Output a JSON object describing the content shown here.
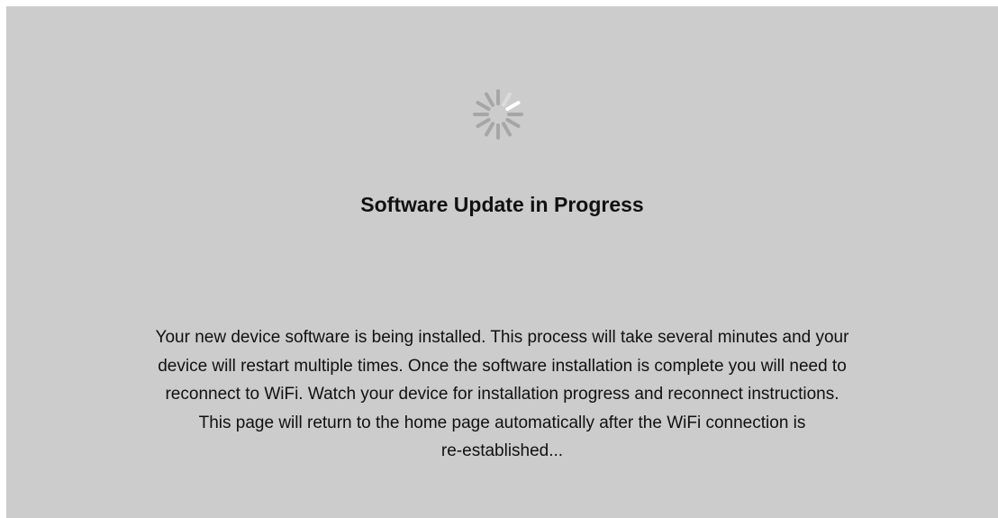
{
  "status": {
    "icon": "loading-spinner-icon",
    "title": "Software Update in Progress",
    "message_lines": [
      "Your new device software is being installed. This process will take several minutes and your",
      "device will restart multiple times. Once the software installation is complete you will need to",
      "reconnect to WiFi. Watch your device for installation progress and reconnect instructions.",
      "This page will return to the home page automatically after the WiFi connection is",
      "re-established..."
    ]
  },
  "colors": {
    "background": "#cccccc",
    "spinner_dim": "#a6a6a6",
    "spinner_bright": "#ffffff"
  }
}
